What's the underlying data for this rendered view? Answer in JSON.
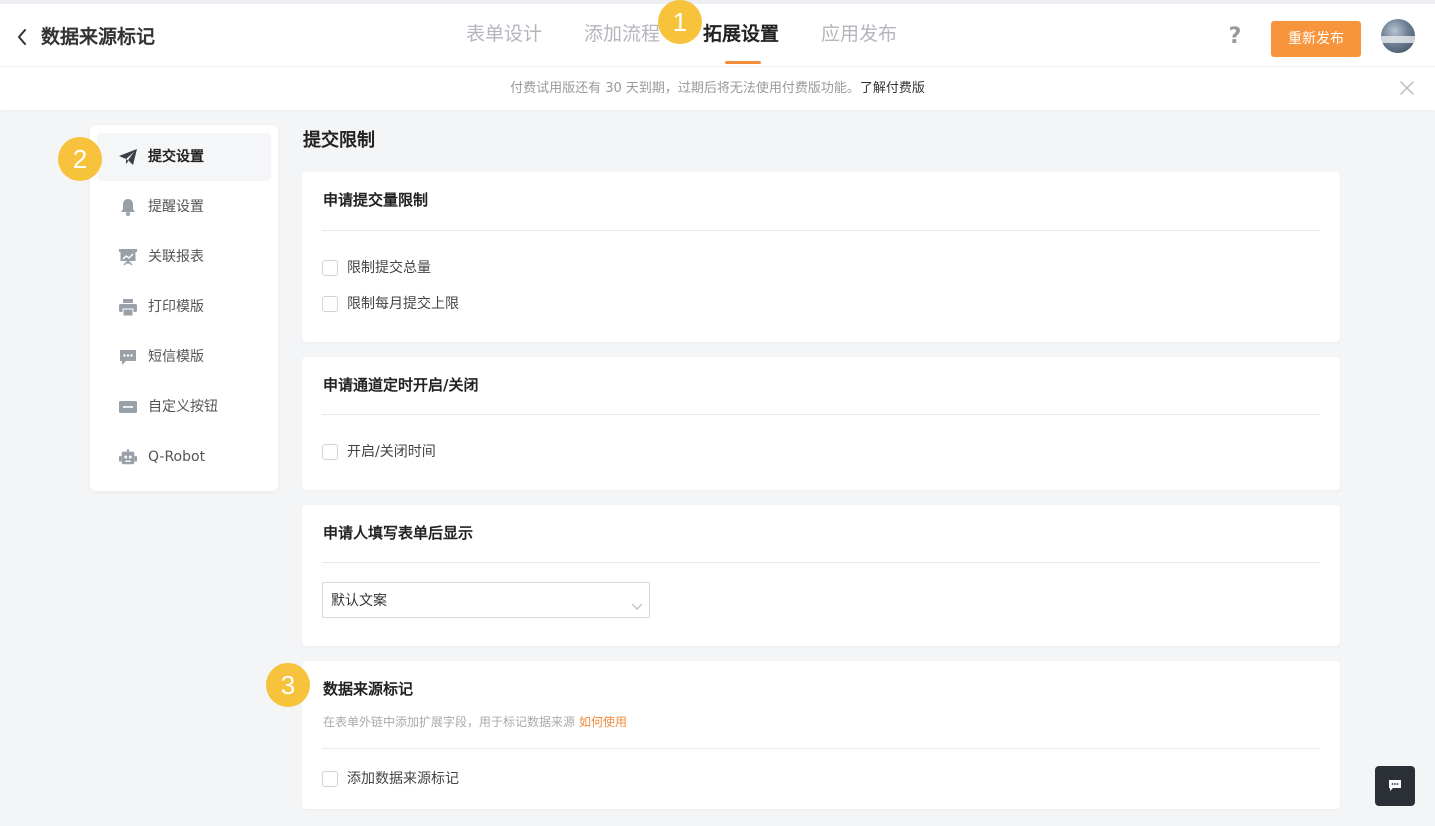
{
  "header": {
    "title": "数据来源标记",
    "tabs": [
      {
        "label": "表单设计",
        "active": false
      },
      {
        "label": "添加流程",
        "active": false
      },
      {
        "label": "拓展设置",
        "active": true
      },
      {
        "label": "应用发布",
        "active": false
      }
    ],
    "help_glyph": "?",
    "publish_label": "重新发布",
    "accent_color": "#f7953d"
  },
  "notice": {
    "text": "付费试用版还有 30 天到期，过期后将无法使用付费版功能。",
    "link": "了解付费版"
  },
  "sidebar": {
    "items": [
      {
        "label": "提交设置",
        "icon": "paper-plane-icon",
        "active": true
      },
      {
        "label": "提醒设置",
        "icon": "bell-icon",
        "active": false
      },
      {
        "label": "关联报表",
        "icon": "report-board-icon",
        "active": false
      },
      {
        "label": "打印模版",
        "icon": "printer-icon",
        "active": false
      },
      {
        "label": "短信模版",
        "icon": "message-icon",
        "active": false
      },
      {
        "label": "自定义按钮",
        "icon": "btn-icon",
        "active": false
      },
      {
        "label": "Q-Robot",
        "icon": "robot-icon",
        "active": false
      }
    ]
  },
  "main": {
    "section_title": "提交限制",
    "cards": [
      {
        "title": "申请提交量限制",
        "options": [
          {
            "label": "限制提交总量",
            "checked": false
          },
          {
            "label": "限制每月提交上限",
            "checked": false
          }
        ]
      },
      {
        "title": "申请通道定时开启/关闭",
        "options": [
          {
            "label": "开启/关闭时间",
            "checked": false
          }
        ]
      },
      {
        "title": "申请人填写表单后显示",
        "select_value": "默认文案"
      },
      {
        "title": "数据来源标记",
        "description": "在表单外链中添加扩展字段，用于标记数据来源",
        "description_link": "如何使用",
        "options": [
          {
            "label": "添加数据来源标记",
            "checked": false
          }
        ]
      }
    ]
  },
  "steps": [
    "1",
    "2",
    "3"
  ],
  "step_color": "#f7c33c"
}
